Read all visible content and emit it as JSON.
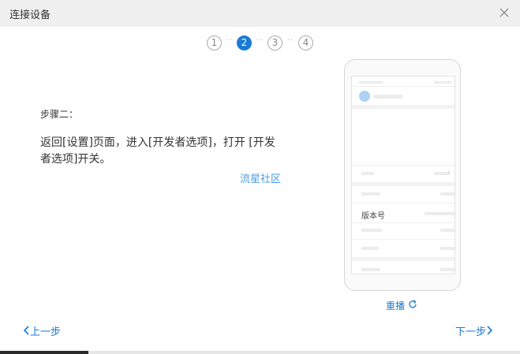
{
  "window": {
    "title": "连接设备",
    "close_icon": "close-icon"
  },
  "steps": [
    {
      "label": "1",
      "active": false
    },
    {
      "label": "2",
      "active": true
    },
    {
      "label": "3",
      "active": false
    },
    {
      "label": "4",
      "active": false
    }
  ],
  "content": {
    "step_title": "步骤二：",
    "description": "返回[设置]页面，进入[开发者选项]，打开 [开发者选项]开关。",
    "community_link": "流星社区"
  },
  "phone": {
    "version_label": "版本号"
  },
  "replay": {
    "label": "重播",
    "icon": "refresh-icon"
  },
  "nav": {
    "prev_label": "上一步",
    "next_label": "下一步",
    "prev_icon": "chevron-left-icon",
    "next_icon": "chevron-right-icon"
  },
  "progress": {
    "value": 0.17
  },
  "colors": {
    "accent": "#1a7bd4",
    "link": "#4a9de0",
    "titlebar": "#f0f0f0"
  }
}
